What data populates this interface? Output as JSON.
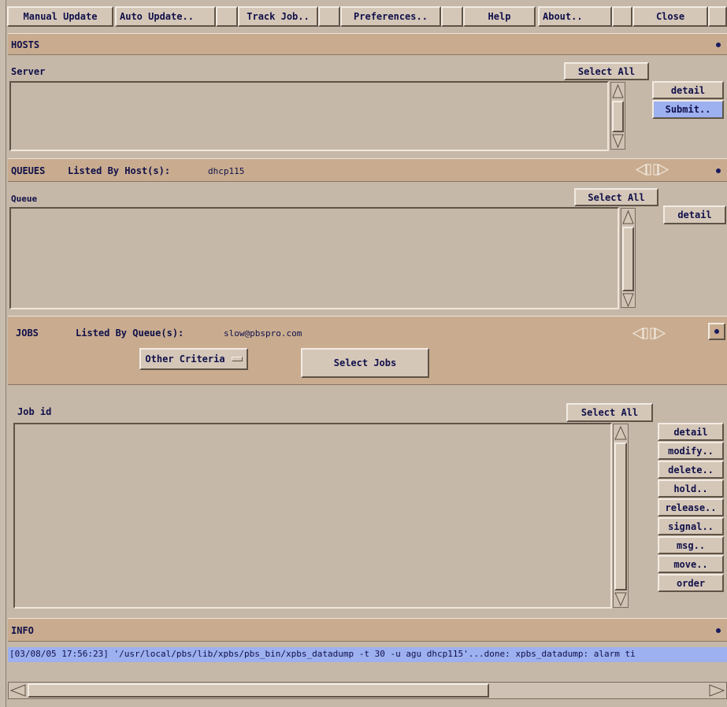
{
  "menubar": {
    "manual_update": "Manual Update",
    "auto_update": "Auto Update..",
    "track_job": "Track Job..",
    "preferences": "Preferences..",
    "help": "Help",
    "about": "About..",
    "close": "Close"
  },
  "hosts": {
    "title": "HOSTS",
    "column": "Server",
    "select_all": "Select All",
    "buttons": {
      "detail": "detail",
      "submit": "Submit.."
    }
  },
  "queues": {
    "title": "QUEUES",
    "listed_by_label": "Listed By Host(s):",
    "listed_by_value": "dhcp115",
    "column": "Queue",
    "select_all": "Select All",
    "buttons": {
      "detail": "detail"
    }
  },
  "jobs": {
    "title": "JOBS",
    "listed_by_label": "Listed By Queue(s):",
    "listed_by_value": "slow@pbspro.com",
    "other_criteria": "Other Criteria",
    "select_jobs": "Select Jobs",
    "column": "Job id",
    "select_all": "Select All",
    "buttons": {
      "detail": "detail",
      "modify": "modify..",
      "delete": "delete..",
      "hold": "hold..",
      "release": "release..",
      "signal": "signal..",
      "msg": "msg..",
      "move": "move..",
      "order": "order"
    }
  },
  "info": {
    "title": "INFO",
    "message": "[03/08/05 17:56:23] '/usr/local/pbs/lib/xpbs/pbs_bin/xpbs_datadump -t 30 -u agu  dhcp115'...done: xpbs_datadump: alarm ti"
  },
  "colors": {
    "background": "#c6b8a8",
    "header": "#c9ac8f",
    "highlight": "#9db0f0",
    "text": "#10104a"
  }
}
